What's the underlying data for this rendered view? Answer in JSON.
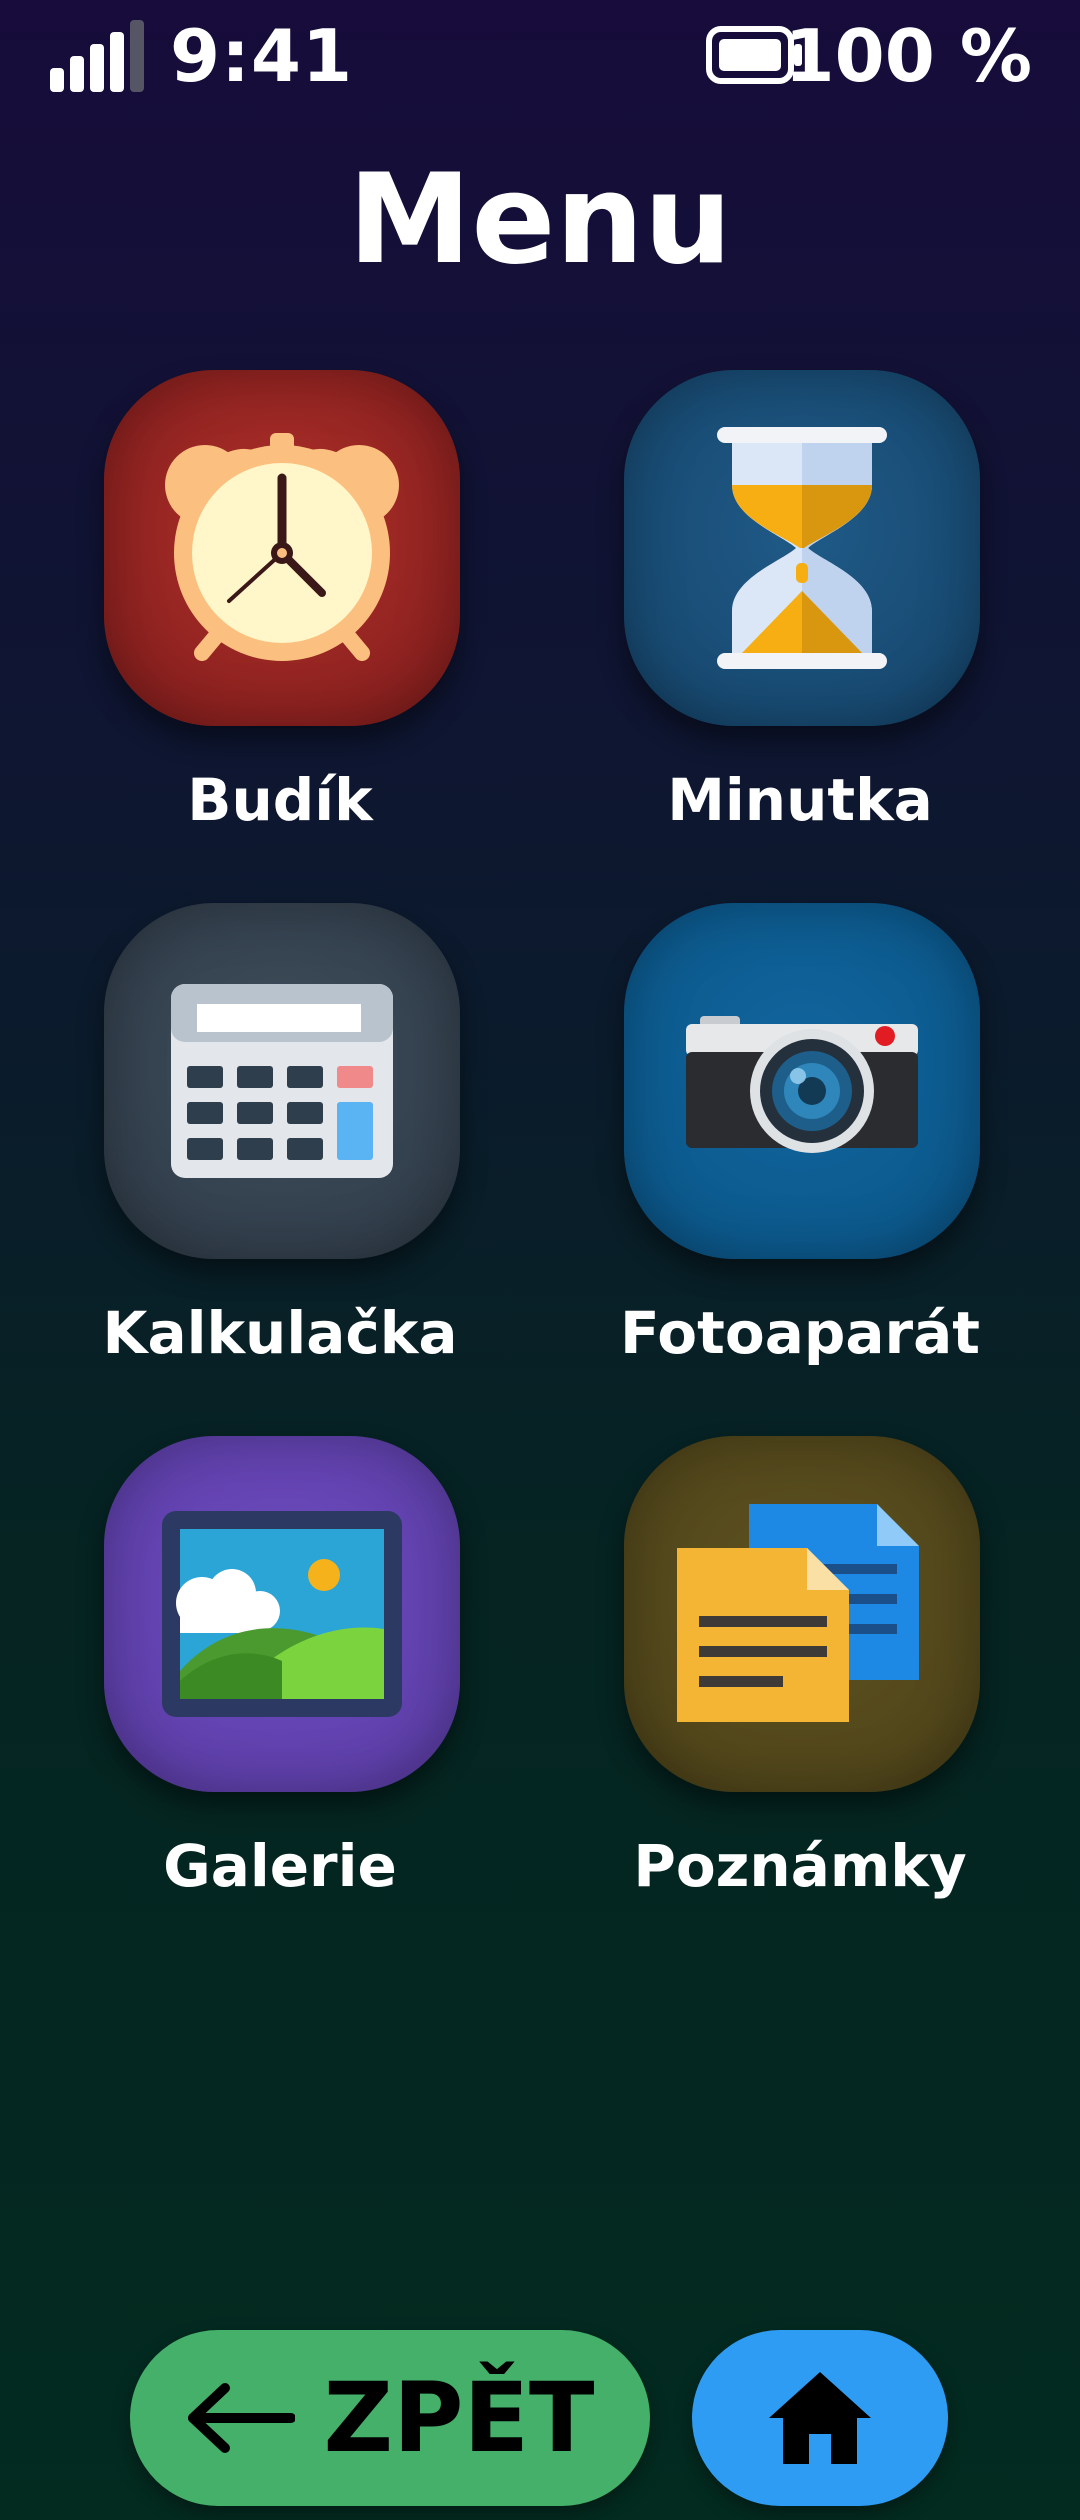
{
  "status_bar": {
    "time": "9:41",
    "battery_text": "100 %",
    "signal_icon": "signal-icon",
    "battery_icon": "battery-icon"
  },
  "header": {
    "title": "Menu"
  },
  "apps": [
    {
      "label": "Budík",
      "icon": "alarm-clock-icon",
      "color": "#8e2220"
    },
    {
      "label": "Minutka",
      "icon": "hourglass-icon",
      "color": "#184b73"
    },
    {
      "label": "Kalkulačka",
      "icon": "calculator-icon",
      "color": "#33404d"
    },
    {
      "label": "Fotoaparát",
      "icon": "camera-icon",
      "color": "#0c5a8e"
    },
    {
      "label": "Galerie",
      "icon": "gallery-icon",
      "color": "#6041ad"
    },
    {
      "label": "Poznámky",
      "icon": "notes-icon",
      "color": "#52471b"
    }
  ],
  "bottom_bar": {
    "back_label": "ZPĚT",
    "back_icon": "arrow-left-icon",
    "home_icon": "home-icon",
    "back_color": "#45b069",
    "home_color": "#2f9cf3"
  }
}
